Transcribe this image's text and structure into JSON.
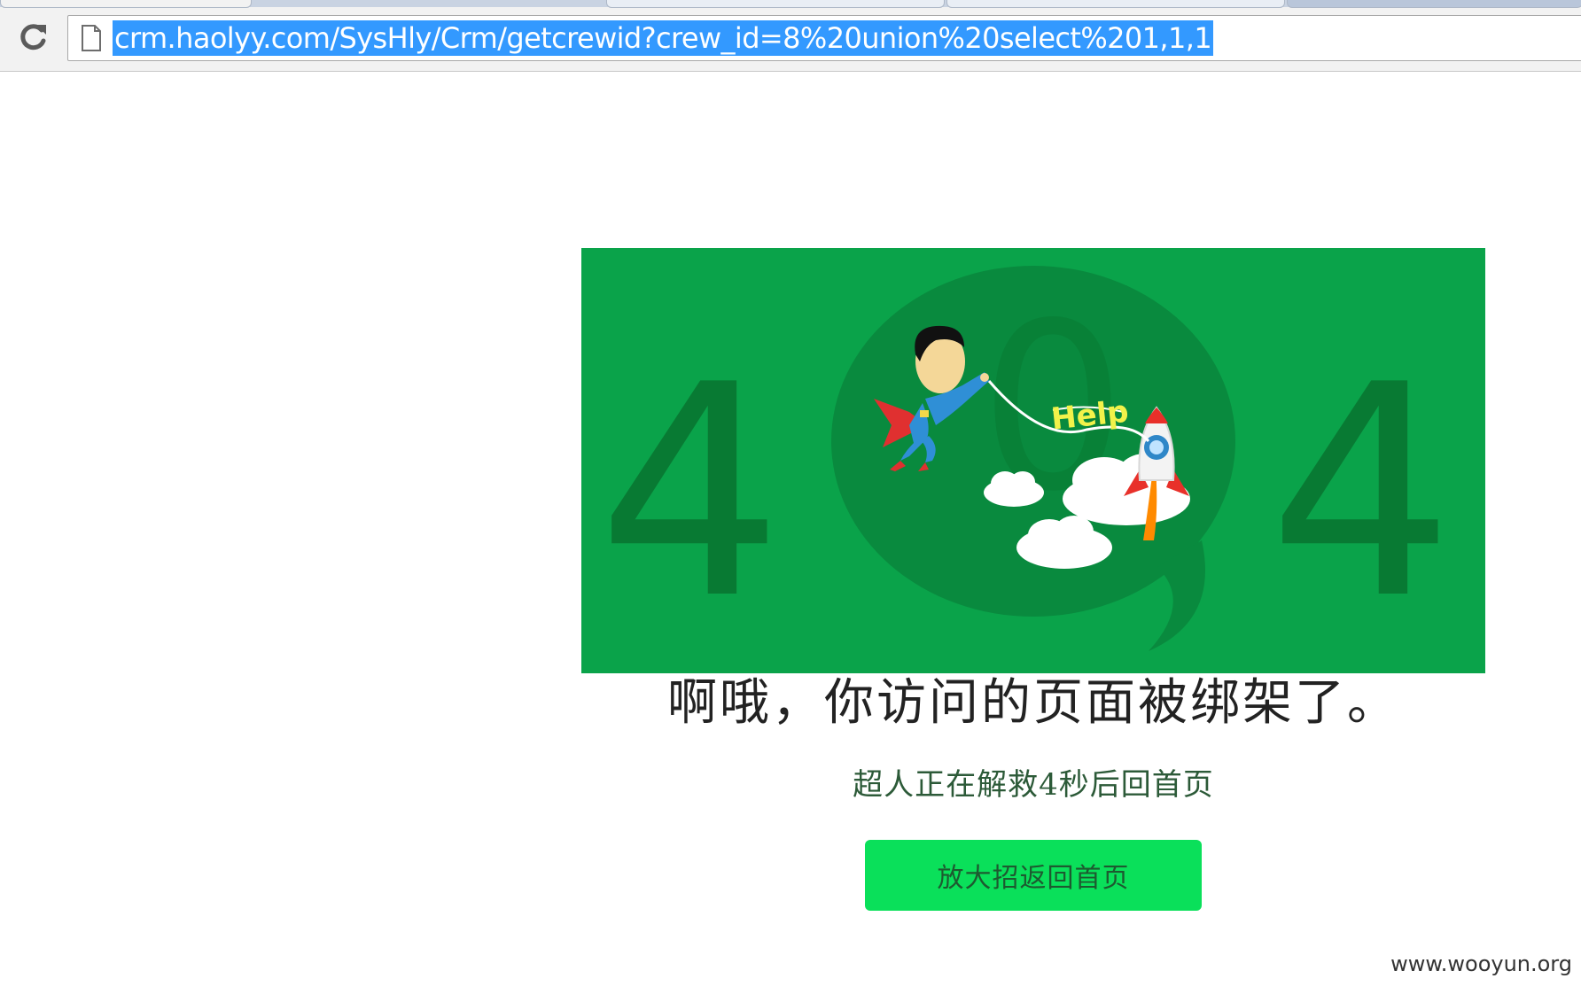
{
  "browser": {
    "address_bar": {
      "url": "crm.haolyy.com/SysHly/Crm/getcrewid?crew_id=8%20union%20select%201,1,1",
      "selected": true
    },
    "reload_icon": "reload-icon",
    "page_icon": "blank-page-icon"
  },
  "error_page": {
    "illustration": {
      "big_digits": [
        "4",
        "0",
        "4"
      ],
      "help_sign": "Help",
      "colors": {
        "background": "#0aa34a",
        "digits": "#087a33",
        "bubble": "#098a3e"
      }
    },
    "headline": "啊哦，你访问的页面被绑架了。",
    "countdown_message": "超人正在解救4秒后回首页",
    "home_button_label": "放大招返回首页",
    "colors": {
      "button": "#0ae05a"
    }
  },
  "watermark": "www.wooyun.org"
}
